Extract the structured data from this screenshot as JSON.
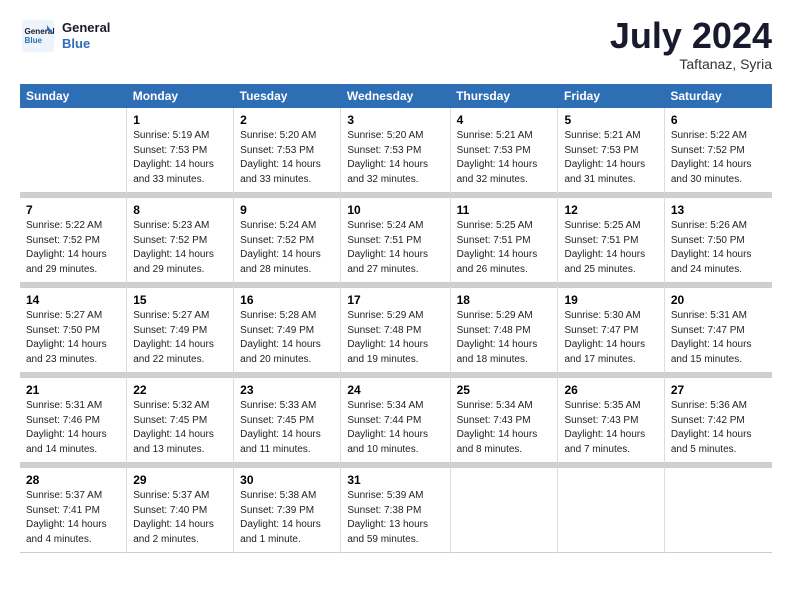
{
  "logo": {
    "line1": "General",
    "line2": "Blue"
  },
  "title": "July 2024",
  "subtitle": "Taftanaz, Syria",
  "days_header": [
    "Sunday",
    "Monday",
    "Tuesday",
    "Wednesday",
    "Thursday",
    "Friday",
    "Saturday"
  ],
  "weeks": [
    [
      {
        "num": "",
        "info": ""
      },
      {
        "num": "1",
        "info": "Sunrise: 5:19 AM\nSunset: 7:53 PM\nDaylight: 14 hours\nand 33 minutes."
      },
      {
        "num": "2",
        "info": "Sunrise: 5:20 AM\nSunset: 7:53 PM\nDaylight: 14 hours\nand 33 minutes."
      },
      {
        "num": "3",
        "info": "Sunrise: 5:20 AM\nSunset: 7:53 PM\nDaylight: 14 hours\nand 32 minutes."
      },
      {
        "num": "4",
        "info": "Sunrise: 5:21 AM\nSunset: 7:53 PM\nDaylight: 14 hours\nand 32 minutes."
      },
      {
        "num": "5",
        "info": "Sunrise: 5:21 AM\nSunset: 7:53 PM\nDaylight: 14 hours\nand 31 minutes."
      },
      {
        "num": "6",
        "info": "Sunrise: 5:22 AM\nSunset: 7:52 PM\nDaylight: 14 hours\nand 30 minutes."
      }
    ],
    [
      {
        "num": "7",
        "info": "Sunrise: 5:22 AM\nSunset: 7:52 PM\nDaylight: 14 hours\nand 29 minutes."
      },
      {
        "num": "8",
        "info": "Sunrise: 5:23 AM\nSunset: 7:52 PM\nDaylight: 14 hours\nand 29 minutes."
      },
      {
        "num": "9",
        "info": "Sunrise: 5:24 AM\nSunset: 7:52 PM\nDaylight: 14 hours\nand 28 minutes."
      },
      {
        "num": "10",
        "info": "Sunrise: 5:24 AM\nSunset: 7:51 PM\nDaylight: 14 hours\nand 27 minutes."
      },
      {
        "num": "11",
        "info": "Sunrise: 5:25 AM\nSunset: 7:51 PM\nDaylight: 14 hours\nand 26 minutes."
      },
      {
        "num": "12",
        "info": "Sunrise: 5:25 AM\nSunset: 7:51 PM\nDaylight: 14 hours\nand 25 minutes."
      },
      {
        "num": "13",
        "info": "Sunrise: 5:26 AM\nSunset: 7:50 PM\nDaylight: 14 hours\nand 24 minutes."
      }
    ],
    [
      {
        "num": "14",
        "info": "Sunrise: 5:27 AM\nSunset: 7:50 PM\nDaylight: 14 hours\nand 23 minutes."
      },
      {
        "num": "15",
        "info": "Sunrise: 5:27 AM\nSunset: 7:49 PM\nDaylight: 14 hours\nand 22 minutes."
      },
      {
        "num": "16",
        "info": "Sunrise: 5:28 AM\nSunset: 7:49 PM\nDaylight: 14 hours\nand 20 minutes."
      },
      {
        "num": "17",
        "info": "Sunrise: 5:29 AM\nSunset: 7:48 PM\nDaylight: 14 hours\nand 19 minutes."
      },
      {
        "num": "18",
        "info": "Sunrise: 5:29 AM\nSunset: 7:48 PM\nDaylight: 14 hours\nand 18 minutes."
      },
      {
        "num": "19",
        "info": "Sunrise: 5:30 AM\nSunset: 7:47 PM\nDaylight: 14 hours\nand 17 minutes."
      },
      {
        "num": "20",
        "info": "Sunrise: 5:31 AM\nSunset: 7:47 PM\nDaylight: 14 hours\nand 15 minutes."
      }
    ],
    [
      {
        "num": "21",
        "info": "Sunrise: 5:31 AM\nSunset: 7:46 PM\nDaylight: 14 hours\nand 14 minutes."
      },
      {
        "num": "22",
        "info": "Sunrise: 5:32 AM\nSunset: 7:45 PM\nDaylight: 14 hours\nand 13 minutes."
      },
      {
        "num": "23",
        "info": "Sunrise: 5:33 AM\nSunset: 7:45 PM\nDaylight: 14 hours\nand 11 minutes."
      },
      {
        "num": "24",
        "info": "Sunrise: 5:34 AM\nSunset: 7:44 PM\nDaylight: 14 hours\nand 10 minutes."
      },
      {
        "num": "25",
        "info": "Sunrise: 5:34 AM\nSunset: 7:43 PM\nDaylight: 14 hours\nand 8 minutes."
      },
      {
        "num": "26",
        "info": "Sunrise: 5:35 AM\nSunset: 7:43 PM\nDaylight: 14 hours\nand 7 minutes."
      },
      {
        "num": "27",
        "info": "Sunrise: 5:36 AM\nSunset: 7:42 PM\nDaylight: 14 hours\nand 5 minutes."
      }
    ],
    [
      {
        "num": "28",
        "info": "Sunrise: 5:37 AM\nSunset: 7:41 PM\nDaylight: 14 hours\nand 4 minutes."
      },
      {
        "num": "29",
        "info": "Sunrise: 5:37 AM\nSunset: 7:40 PM\nDaylight: 14 hours\nand 2 minutes."
      },
      {
        "num": "30",
        "info": "Sunrise: 5:38 AM\nSunset: 7:39 PM\nDaylight: 14 hours\nand 1 minute."
      },
      {
        "num": "31",
        "info": "Sunrise: 5:39 AM\nSunset: 7:38 PM\nDaylight: 13 hours\nand 59 minutes."
      },
      {
        "num": "",
        "info": ""
      },
      {
        "num": "",
        "info": ""
      },
      {
        "num": "",
        "info": ""
      }
    ]
  ]
}
